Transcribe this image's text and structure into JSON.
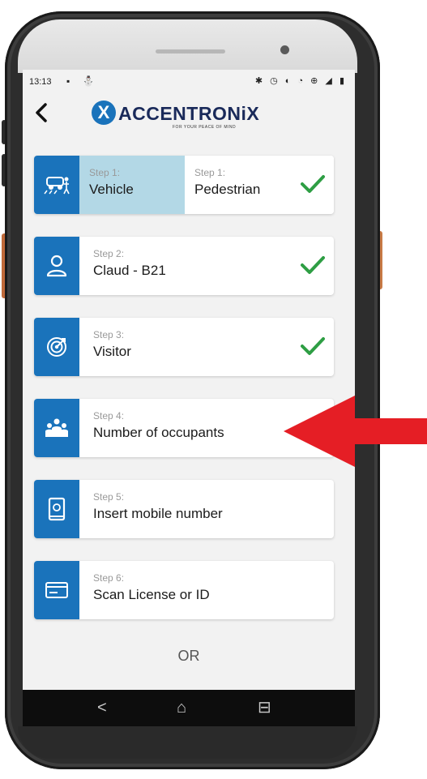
{
  "status_bar": {
    "time": "13:13",
    "left_icons": "▪ ⛄",
    "right_icons": "✱ ◷ ◐ ◔ ⊕ ◢ ▮"
  },
  "app_bar": {
    "back_icon": "chevron-left-icon",
    "logo_text": "ACCENTRONiX",
    "logo_tagline": "FOR YOUR PEACE OF MIND",
    "logo_mark": "X"
  },
  "steps": {
    "step1_vehicle": {
      "label": "Step 1:",
      "value": "Vehicle",
      "icon": "vehicle-icon",
      "selected": true
    },
    "step1_pedestrian": {
      "label": "Step 1:",
      "value": "Pedestrian",
      "completed": true
    },
    "step2": {
      "label": "Step 2:",
      "value": "Claud - B21",
      "icon": "user-icon",
      "completed": true
    },
    "step3": {
      "label": "Step 3:",
      "value": "Visitor",
      "icon": "target-icon",
      "completed": true
    },
    "step4": {
      "label": "Step 4:",
      "value": "Number of occupants",
      "icon": "group-icon",
      "completed": false
    },
    "step5": {
      "label": "Step 5:",
      "value": "Insert mobile number",
      "icon": "mobile-phone-icon",
      "completed": false
    },
    "step6": {
      "label": "Step 6:",
      "value": "Scan License or ID",
      "icon": "id-card-icon",
      "completed": false
    }
  },
  "or_text": "OR",
  "nav_bar": {
    "back": "<",
    "home": "⌂",
    "recents": "⊟"
  },
  "colors": {
    "accent_blue": "#1a73bb",
    "selected_bg": "#b3d8e6",
    "check_green": "#2e9e44",
    "arrow_red": "#e51e25"
  }
}
